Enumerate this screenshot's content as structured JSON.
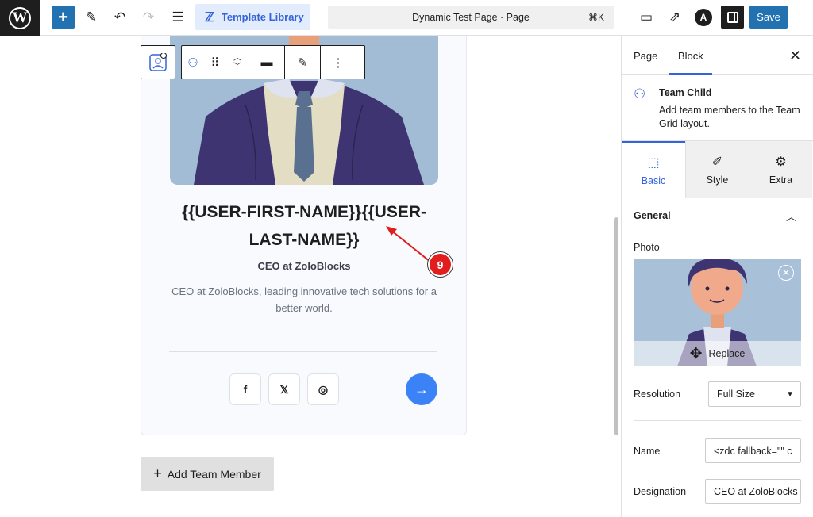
{
  "topbar": {
    "wp_logo": "W",
    "template_library": "Template Library",
    "document_title": "Dynamic Test Page · Page",
    "shortcut": "⌘K",
    "astra_letter": "A",
    "save_label": "Save"
  },
  "card": {
    "name": "{{USER-FIRST-NAME}}{{USER-LAST-NAME}}",
    "name_line1": "{{USER-FIRST-NAME}}{{USER-",
    "name_line2": "LAST-NAME}}",
    "designation": "CEO at ZoloBlocks",
    "bio": "CEO at ZoloBlocks, leading innovative tech solutions for a better world.",
    "social": [
      "f",
      "𝕏",
      "◎"
    ]
  },
  "add_member_label": "Add Team Member",
  "annotation_marker": "9",
  "sidebar": {
    "tabs": [
      "Page",
      "Block"
    ],
    "active_tab": "Block",
    "block": {
      "name": "Team Child",
      "description": "Add team members to the Team Grid layout."
    },
    "subtabs": [
      {
        "label": "Basic",
        "icon": "cursor-icon"
      },
      {
        "label": "Style",
        "icon": "brush-icon"
      },
      {
        "label": "Extra",
        "icon": "gear-icon"
      }
    ],
    "active_subtab": "Basic",
    "section": "General",
    "photo_label": "Photo",
    "replace_label": "Replace",
    "resolution_label": "Resolution",
    "resolution_value": "Full Size",
    "name_label": "Name",
    "name_value": "<zdc fallback=\"\" c",
    "designation_label": "Designation",
    "designation_value": "CEO at ZoloBlocks"
  },
  "colors": {
    "accent": "#2271b1",
    "zolo_blue": "#3563d9",
    "marker_red": "#e11d1d",
    "arrow_button": "#3b82f6"
  }
}
